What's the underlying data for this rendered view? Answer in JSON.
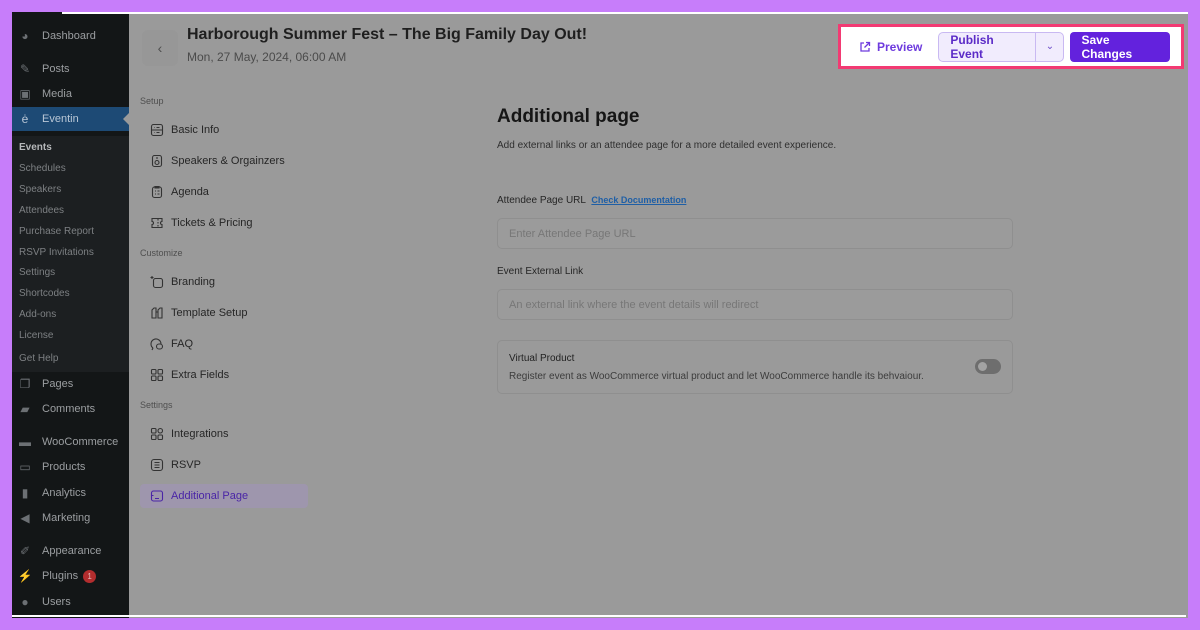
{
  "wp_sidebar": {
    "items": [
      {
        "label": "Dashboard",
        "icon": "dashboard-icon"
      },
      {
        "label": "Posts",
        "icon": "pin-icon"
      },
      {
        "label": "Media",
        "icon": "media-icon"
      },
      {
        "label": "Eventin",
        "icon": "eventin-icon",
        "active": true
      },
      {
        "label": "Pages",
        "icon": "pages-icon"
      },
      {
        "label": "Comments",
        "icon": "comment-icon"
      },
      {
        "label": "WooCommerce",
        "icon": "woo-icon"
      },
      {
        "label": "Products",
        "icon": "archive-icon"
      },
      {
        "label": "Analytics",
        "icon": "chart-bar-icon"
      },
      {
        "label": "Marketing",
        "icon": "megaphone-icon"
      },
      {
        "label": "Appearance",
        "icon": "brush-icon"
      },
      {
        "label": "Plugins",
        "icon": "plug-icon",
        "badge": "1"
      },
      {
        "label": "Users",
        "icon": "user-icon"
      }
    ],
    "submenu": [
      "Events",
      "Schedules",
      "Speakers",
      "Attendees",
      "Purchase Report",
      "RSVP Invitations",
      "Settings",
      "Shortcodes",
      "Add-ons",
      "License",
      "Get Help"
    ],
    "submenu_current": "Events"
  },
  "header": {
    "title": "Harborough Summer Fest – The Big Family Day Out!",
    "date": "Mon, 27 May, 2024, 06:00 AM",
    "back_icon": "chevron-left-icon"
  },
  "actions": {
    "preview_label": "Preview",
    "publish_label": "Publish Event",
    "save_label": "Save Changes",
    "highlight_color": "#f23a73",
    "primary_color": "#6322dd"
  },
  "event_nav": {
    "sections": [
      {
        "title": "Setup",
        "items": [
          "Basic Info",
          "Speakers & Orgainzers",
          "Agenda",
          "Tickets & Pricing"
        ]
      },
      {
        "title": "Customize",
        "items": [
          "Branding",
          "Template Setup",
          "FAQ",
          "Extra Fields"
        ]
      },
      {
        "title": "Settings",
        "items": [
          "Integrations",
          "RSVP",
          "Additional Page"
        ]
      }
    ],
    "active": "Additional Page"
  },
  "main": {
    "title": "Additional page",
    "description": "Add external links or an attendee page for a more detailed event experience.",
    "attendee_label": "Attendee Page URL",
    "doc_link": "Check Documentation",
    "attendee_placeholder": "Enter Attendee Page URL",
    "attendee_value": "",
    "external_label": "Event External Link",
    "external_placeholder": "An external link where the event details will redirect",
    "external_value": "",
    "virtual_title": "Virtual Product",
    "virtual_desc": "Register event as WooCommerce virtual product and let WooCommerce handle its behvaiour.",
    "virtual_enabled": false
  }
}
